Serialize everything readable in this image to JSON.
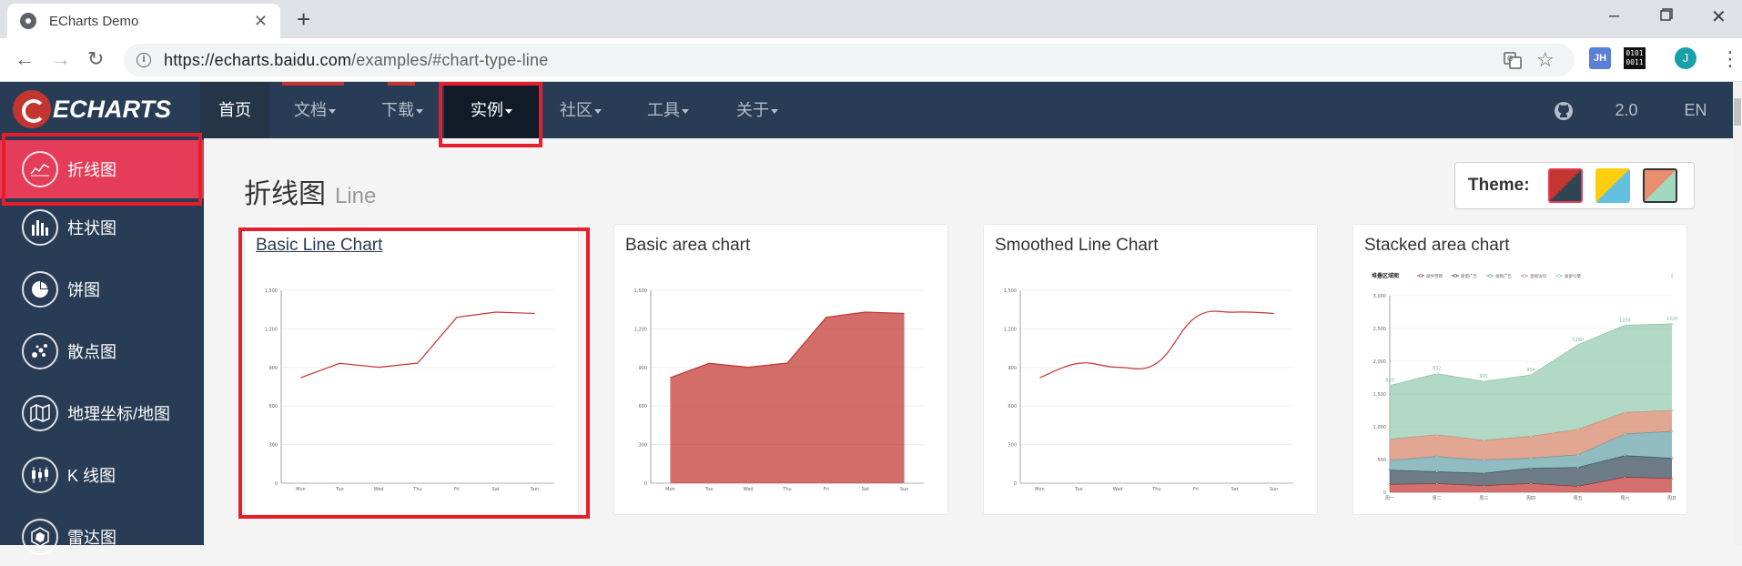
{
  "browser": {
    "tab_title": "ECharts Demo",
    "tab_close": "✕",
    "new_tab": "+",
    "url_host": "https://echarts.baidu.com",
    "url_path": "/examples/#chart-type-line",
    "ext_jh": "JH",
    "ext_bin": "0101\n0011",
    "profile": "J"
  },
  "header": {
    "logo": "ECHARTS",
    "nav": [
      {
        "label": "首页"
      },
      {
        "label": "文档"
      },
      {
        "label": "下载"
      },
      {
        "label": "实例"
      },
      {
        "label": "社区"
      },
      {
        "label": "工具"
      },
      {
        "label": "关于"
      }
    ],
    "version": "2.0",
    "lang": "EN"
  },
  "sidebar": {
    "items": [
      {
        "label": "折线图",
        "icon": "line-chart-icon"
      },
      {
        "label": "柱状图",
        "icon": "bar-chart-icon"
      },
      {
        "label": "饼图",
        "icon": "pie-chart-icon"
      },
      {
        "label": "散点图",
        "icon": "scatter-chart-icon"
      },
      {
        "label": "地理坐标/地图",
        "icon": "map-icon"
      },
      {
        "label": "K 线图",
        "icon": "candlestick-icon"
      },
      {
        "label": "雷达图",
        "icon": "radar-chart-icon"
      }
    ]
  },
  "main": {
    "title": "折线图",
    "subtitle": "Line",
    "theme_label": "Theme:",
    "theme_colors": [
      "#c23531",
      "#2f4554",
      "#fcce10",
      "#60c0dd",
      "#e98f6f",
      "#9fdabf"
    ]
  },
  "cards": [
    {
      "title": "Basic Line Chart"
    },
    {
      "title": "Basic area chart"
    },
    {
      "title": "Smoothed Line Chart"
    },
    {
      "title": "Stacked area chart"
    }
  ],
  "chart_data": [
    {
      "type": "line",
      "categories": [
        "Mon",
        "Tue",
        "Wed",
        "Thu",
        "Fri",
        "Sat",
        "Sun"
      ],
      "values": [
        820,
        932,
        901,
        934,
        1290,
        1330,
        1320
      ],
      "ylim": [
        0,
        1500
      ],
      "yticks": [
        "0",
        "300",
        "600",
        "900",
        "1,200",
        "1,500"
      ],
      "color": "#c23531"
    },
    {
      "type": "area",
      "categories": [
        "Mon",
        "Tue",
        "Wed",
        "Thu",
        "Fri",
        "Sat",
        "Sun"
      ],
      "values": [
        820,
        932,
        901,
        934,
        1290,
        1330,
        1320
      ],
      "ylim": [
        0,
        1500
      ],
      "yticks": [
        "0",
        "300",
        "600",
        "900",
        "1,200",
        "1,500"
      ],
      "color": "#c23531"
    },
    {
      "type": "line",
      "smooth": true,
      "categories": [
        "Mon",
        "Tue",
        "Wed",
        "Thu",
        "Fri",
        "Sat",
        "Sun"
      ],
      "values": [
        820,
        932,
        901,
        934,
        1290,
        1330,
        1320
      ],
      "ylim": [
        0,
        1500
      ],
      "yticks": [
        "0",
        "300",
        "600",
        "900",
        "1,200",
        "1,500"
      ],
      "color": "#c23531"
    },
    {
      "type": "area",
      "stacked": true,
      "title": "堆叠区域图",
      "categories": [
        "周一",
        "周二",
        "周三",
        "周四",
        "周五",
        "周六",
        "周日"
      ],
      "ylim": [
        0,
        3000
      ],
      "yticks": [
        "0",
        "500",
        "1,000",
        "1,500",
        "2,000",
        "2,500",
        "3,000"
      ],
      "series": [
        {
          "name": "邮件营销",
          "values": [
            120,
            132,
            101,
            134,
            90,
            230,
            210
          ],
          "color": "#c23531"
        },
        {
          "name": "联盟广告",
          "values": [
            220,
            182,
            191,
            234,
            290,
            330,
            310
          ],
          "color": "#2f4554"
        },
        {
          "name": "视频广告",
          "values": [
            150,
            232,
            201,
            154,
            190,
            330,
            410
          ],
          "color": "#61a0a8"
        },
        {
          "name": "直接访问",
          "values": [
            320,
            332,
            301,
            334,
            390,
            330,
            320
          ],
          "color": "#d48265"
        },
        {
          "name": "搜索引擎",
          "values": [
            820,
            932,
            901,
            934,
            1290,
            1330,
            1320
          ],
          "color": "#91c7ae"
        }
      ],
      "top_labels": [
        "820",
        "932",
        "901",
        "934",
        "1290",
        "1330",
        "1320"
      ]
    }
  ]
}
